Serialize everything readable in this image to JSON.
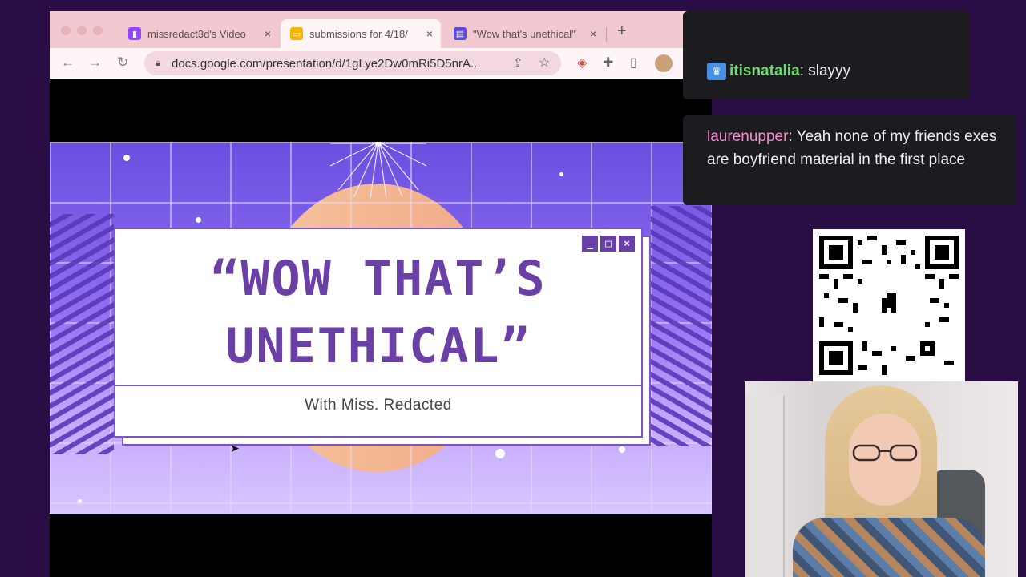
{
  "browser": {
    "tabs": [
      {
        "title": "missredact3d's Video",
        "icon": "twitch-icon",
        "icon_color": "#9146ff",
        "active": false
      },
      {
        "title": "submissions for 4/18/",
        "icon": "slides-icon",
        "icon_color": "#f4b400",
        "active": true
      },
      {
        "title": "\"Wow that's unethical\"",
        "icon": "form-icon",
        "icon_color": "#5b4bdb",
        "active": false
      }
    ],
    "new_tab_symbol": "+",
    "close_symbol": "×",
    "url": "docs.google.com/presentation/d/1gLye2Dw0mRi5D5nrA..."
  },
  "slide": {
    "title_line1": "“WOW THAT’S",
    "title_line2": "UNETHICAL”",
    "subtitle": "With Miss. Redacted",
    "window_buttons": [
      "_",
      "□",
      "×"
    ],
    "colors": {
      "accent": "#6a3fa6",
      "sun": "#f0b08c",
      "bg_top": "#6a4ee0"
    }
  },
  "chat": [
    {
      "username": "itisnatalia",
      "text": "slayyy",
      "color": "#6cdc6c",
      "badge": "crown-icon"
    },
    {
      "username": "laurenupper",
      "text": "Yeah none of my friends exes are boyfriend material in the first place",
      "color": "#f48fd0"
    }
  ],
  "overlay": {
    "qr_code": "qr-code-with-dino-icon",
    "webcam": "streamer-webcam"
  }
}
